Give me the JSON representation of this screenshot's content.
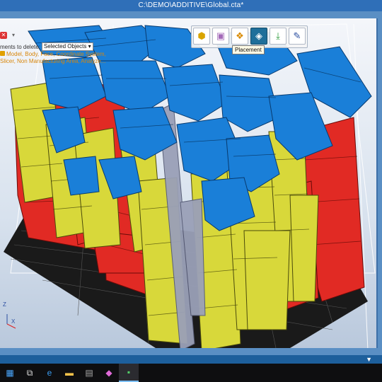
{
  "window": {
    "title": "C:\\DEMO\\ADDITIVE\\Global.cta*"
  },
  "delete_panel": {
    "label": "ments to delete:",
    "select_value": "Selected Objects",
    "select_arrow": "▾",
    "types_text": "Model, Body, Face, Coordinate System, Slicer, Non Manufacturing Area, Analyze..."
  },
  "toolbar": {
    "tools": [
      "part-icon",
      "box-icon",
      "parts-icon",
      "placement-icon",
      "export-icon",
      "edit-icon"
    ],
    "tooltip": "Placement"
  },
  "axes": {
    "z": "Z",
    "x": "X"
  },
  "statusbar": {
    "filter_icon": "▼"
  },
  "taskbar": {
    "items": [
      "windows-start-icon",
      "task-view-icon",
      "edge-icon",
      "file-explorer-icon",
      "app-icon",
      "paint-icon",
      "cad-app-icon"
    ]
  },
  "colors": {
    "red_parts": "#e12a24",
    "yellow_parts": "#d8d83a",
    "blue_parts": "#1a7fd8",
    "bed": "#1a1a1a"
  }
}
